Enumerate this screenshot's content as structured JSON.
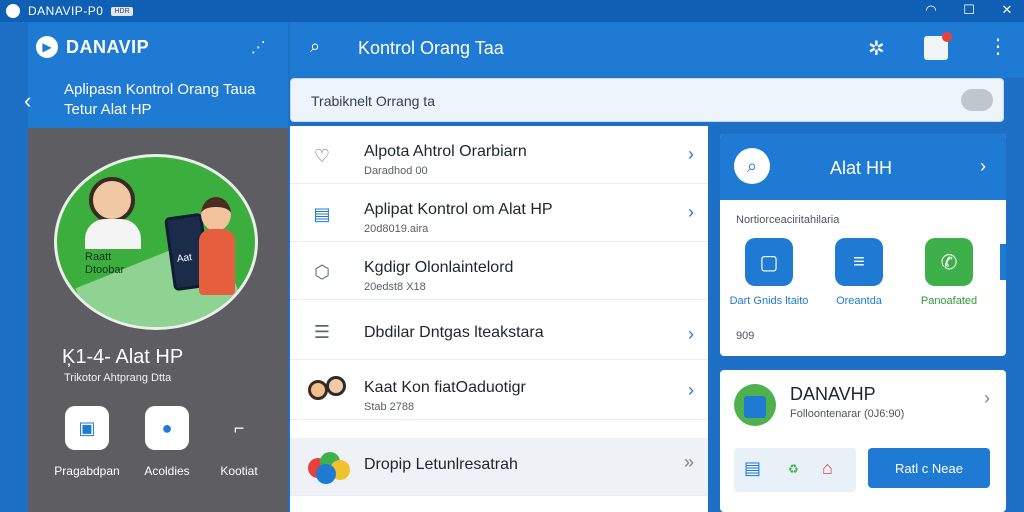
{
  "window": {
    "title": "DANAVIP-P0",
    "badge": "HDR",
    "controls": [
      "wifi-icon",
      "maximize-icon",
      "close-icon"
    ]
  },
  "sidebar": {
    "brand": "DANAVIP",
    "header_line1": "Aplipasn Kontrol Orang Taua",
    "header_line2": "Tetur Alat HP",
    "hero_caption": "Raatt Dtoobar",
    "hero_phone_text": "Aat",
    "title": "Ķ1-4- Alat HP",
    "subtitle": "Trikotor Ahtprang Dtta",
    "quick_actions": [
      {
        "label": "Pragabdpan",
        "icon": "toolbox-icon"
      },
      {
        "label": "Acoldies",
        "icon": "person-icon"
      },
      {
        "label": "Kootiat",
        "icon": "tool-icon"
      }
    ]
  },
  "topbar": {
    "title": "Kontrol Orang Taa",
    "icons": [
      "search-icon",
      "gear-icon",
      "avatar-icon",
      "more-icon"
    ]
  },
  "search": {
    "value": "Trabiknelt Orrang ta"
  },
  "list": [
    {
      "title": "Alpota Ahtrol Orarbiarn",
      "sub": "Daradhod 00",
      "icon": "shield-heart-icon"
    },
    {
      "title": "Aplipat Kontrol om Alat HP",
      "sub": "20d8019.aira",
      "icon": "document-icon"
    },
    {
      "title": "Kgdigr Olonlaintelord",
      "sub": "20edst8 X18",
      "icon": "puzzle-icon"
    },
    {
      "title": "Dbdilar Dntgas lteakstara",
      "sub": "",
      "icon": "list-icon"
    },
    {
      "title": "Kaat Kon fiatOaduotigr",
      "sub": "Stab 2788",
      "icon": "family-icon"
    },
    {
      "title": "Dropip Letunlresatrah",
      "sub": "",
      "icon": "colorful-apps-icon"
    }
  ],
  "card_alat": {
    "title": "Alat HH",
    "subtitle": "Nortiorceaciritahilaria",
    "apps": [
      {
        "label": "Dart Gnids ltaito",
        "color": "#1f7ad4"
      },
      {
        "label": "Oreantda",
        "color": "#1f7ad4"
      },
      {
        "label": "Panoafated",
        "color": "#3eb04a"
      }
    ],
    "count": "909"
  },
  "card_danavip": {
    "title": "DANAVHP",
    "subtitle": "Folloontenarar (0J6:90)",
    "button": "Ratl c Neae"
  }
}
